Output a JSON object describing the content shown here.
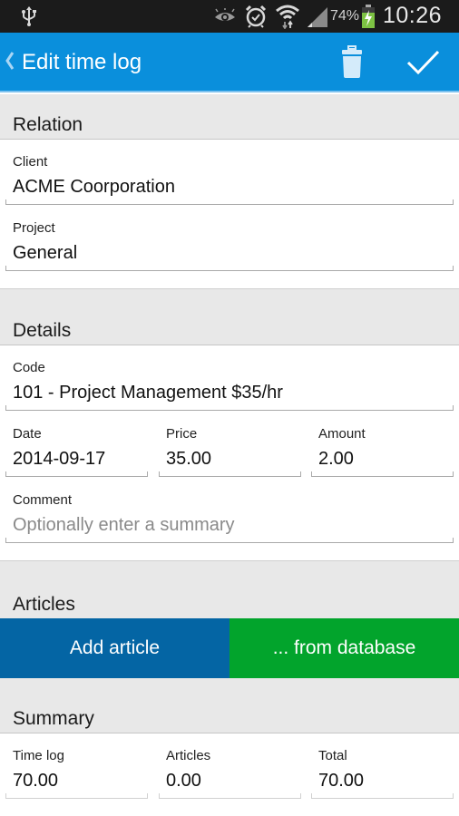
{
  "status_bar": {
    "icons": [
      "usb-icon",
      "eye-icon",
      "alarm-icon",
      "wifi-icon",
      "signal-icon",
      "battery-icon"
    ],
    "battery_percent": "74%",
    "time": "10:26"
  },
  "action_bar": {
    "title": "Edit time log",
    "back_icon": "chevron-left-icon",
    "actions": [
      {
        "name": "delete",
        "icon": "trash-icon"
      },
      {
        "name": "confirm",
        "icon": "checkmark-icon"
      }
    ],
    "color": "#0a8fdc"
  },
  "relation": {
    "header": "Relation",
    "client": {
      "label": "Client",
      "value": "ACME Coorporation"
    },
    "project": {
      "label": "Project",
      "value": "General"
    }
  },
  "details": {
    "header": "Details",
    "code": {
      "label": "Code",
      "value": "101 - Project Management $35/hr"
    },
    "date": {
      "label": "Date",
      "value": "2014-09-17"
    },
    "price": {
      "label": "Price",
      "value": "35.00"
    },
    "amount": {
      "label": "Amount",
      "value": "2.00"
    },
    "comment": {
      "label": "Comment",
      "value": "",
      "placeholder": "Optionally enter a summary"
    }
  },
  "articles": {
    "header": "Articles",
    "add_article_label": "Add article",
    "from_database_label": "... from database",
    "add_color": "#0465a4",
    "database_color": "#02a42c"
  },
  "summary": {
    "header": "Summary",
    "time_log": {
      "label": "Time log",
      "value": "70.00"
    },
    "articles": {
      "label": "Articles",
      "value": "0.00"
    },
    "total": {
      "label": "Total",
      "value": "70.00"
    }
  }
}
